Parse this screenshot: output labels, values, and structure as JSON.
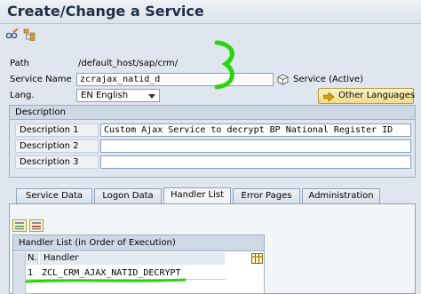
{
  "window": {
    "title": "Create/Change a Service"
  },
  "toolbar": {
    "icons": [
      "glasses-pencil-icon",
      "hierarchy-icon"
    ]
  },
  "form": {
    "path_label": "Path",
    "path_value": "/default_host/sap/crm/",
    "service_name_label": "Service Name",
    "service_name_value": "zcrajax_natid_d",
    "service_status": "Service (Active)",
    "lang_label": "Lang.",
    "lang_value": "EN English",
    "other_languages_button": "Other Languages"
  },
  "description": {
    "header": "Description",
    "rows": [
      {
        "label": "Description 1",
        "value": "Custom Ajax Service to decrypt BP National Register ID"
      },
      {
        "label": "Description 2",
        "value": ""
      },
      {
        "label": "Description 3",
        "value": ""
      }
    ]
  },
  "tabs": [
    {
      "label": "Service Data",
      "active": false
    },
    {
      "label": "Logon Data",
      "active": false
    },
    {
      "label": "Handler List",
      "active": true
    },
    {
      "label": "Error Pages",
      "active": false
    },
    {
      "label": "Administration",
      "active": false
    }
  ],
  "handler_list": {
    "title": "Handler List (in Order of Execution)",
    "columns": [
      "N.",
      "Handler"
    ],
    "rows": [
      {
        "n": "1",
        "handler": "ZCL_CRM_AJAX_NATID_DECRYPT"
      }
    ]
  },
  "colors": {
    "annotation": "#2bd40f",
    "button_bg": "#efdc8a",
    "tab_bg": "#d5dee8"
  }
}
